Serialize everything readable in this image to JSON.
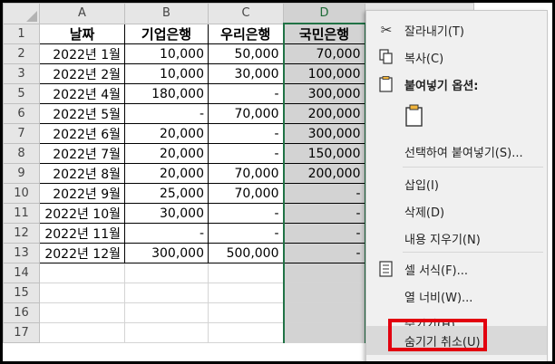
{
  "columns": [
    "A",
    "B",
    "C",
    "D"
  ],
  "selected_column": "D",
  "header_row": [
    "날짜",
    "기업은행",
    "우리은행",
    "국민은행"
  ],
  "rows": [
    {
      "n": "2",
      "a": "2022년 1월",
      "b": "10,000",
      "c": "50,000",
      "d": "70,000"
    },
    {
      "n": "3",
      "a": "2022년 2월",
      "b": "10,000",
      "c": "30,000",
      "d": "100,000"
    },
    {
      "n": "5",
      "a": "2022년 4월",
      "b": "180,000",
      "c": "-",
      "d": "300,000"
    },
    {
      "n": "6",
      "a": "2022년 5월",
      "b": "-",
      "c": "70,000",
      "d": "200,000"
    },
    {
      "n": "7",
      "a": "2022년 6월",
      "b": "20,000",
      "c": "-",
      "d": "300,000"
    },
    {
      "n": "8",
      "a": "2022년 7월",
      "b": "20,000",
      "c": "-",
      "d": "150,000"
    },
    {
      "n": "9",
      "a": "2022년 8월",
      "b": "20,000",
      "c": "70,000",
      "d": "200,000"
    },
    {
      "n": "10",
      "a": "2022년 9월",
      "b": "25,000",
      "c": "70,000",
      "d": "-"
    },
    {
      "n": "11",
      "a": "2022년 10월",
      "b": "30,000",
      "c": "-",
      "d": "-"
    },
    {
      "n": "12",
      "a": "2022년 11월",
      "b": "-",
      "c": "-",
      "d": "-"
    },
    {
      "n": "13",
      "a": "2022년 12월",
      "b": "300,000",
      "c": "500,000",
      "d": "-"
    }
  ],
  "empty_rows": [
    "14",
    "15",
    "16",
    "17"
  ],
  "menu": {
    "cut": "잘라내기(T)",
    "copy": "복사(C)",
    "paste_options": "붙여넣기 옵션:",
    "paste_special": "선택하여 붙여넣기(S)...",
    "insert": "삽입(I)",
    "delete": "삭제(D)",
    "clear_contents": "내용 지우기(N)",
    "format_cells": "셀 서식(F)...",
    "column_width": "열 너비(W)...",
    "hide": "숨기기(H)",
    "unhide": "숨기기 취소(U)"
  },
  "highlight_color": "#e2000f",
  "selection_color": "#217346"
}
